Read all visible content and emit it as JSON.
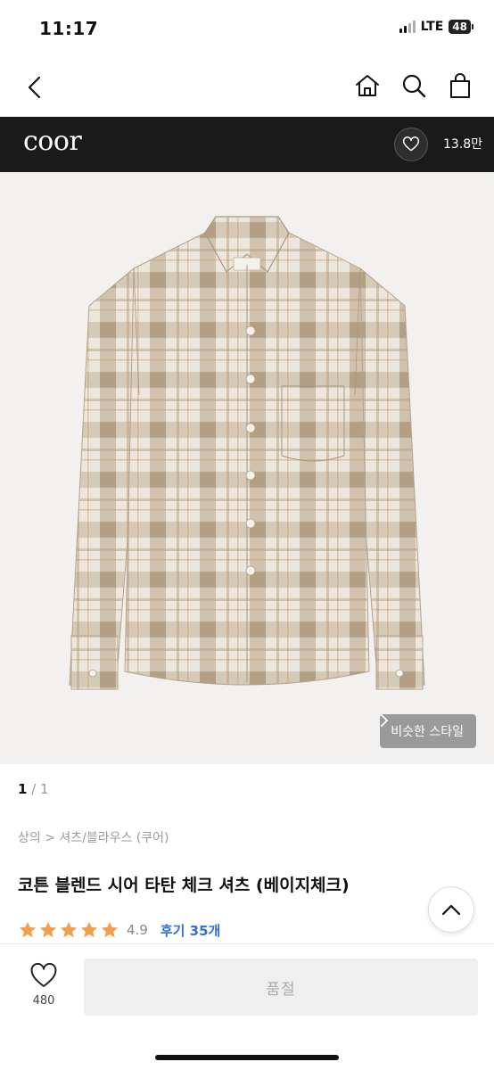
{
  "status_bar": {
    "time": "11:17",
    "network": "LTE",
    "battery": "48"
  },
  "nav": {
    "back_icon": "chevron-left-icon",
    "home_icon": "home-icon",
    "search_icon": "search-icon",
    "bag_icon": "shopping-bag-icon"
  },
  "brand": {
    "logo": "coor",
    "like_count": "13.8만",
    "like_icon": "heart-icon"
  },
  "image": {
    "description_icon": "product-photo",
    "similar_style_label": "비슷한 스타일",
    "shirt_colors": {
      "base": "#ece6dc",
      "check_dark": "#b9a891",
      "check_mid": "#cfc2ae",
      "line": "#a08c72"
    }
  },
  "pager": {
    "current": "1",
    "total": "/ 1"
  },
  "breadcrumb": "상의 > 셔츠/블라우스 (쿠어)",
  "product": {
    "title": "코튼 블렌드 시어 타탄 체크 셔츠 (베이지체크)",
    "rating": 4.9,
    "rating_text": "4.9",
    "star_color": "#f0a04b",
    "reviews": "후기 35개"
  },
  "bottom_bar": {
    "wish_count": "480",
    "soldout_label": "품절"
  }
}
